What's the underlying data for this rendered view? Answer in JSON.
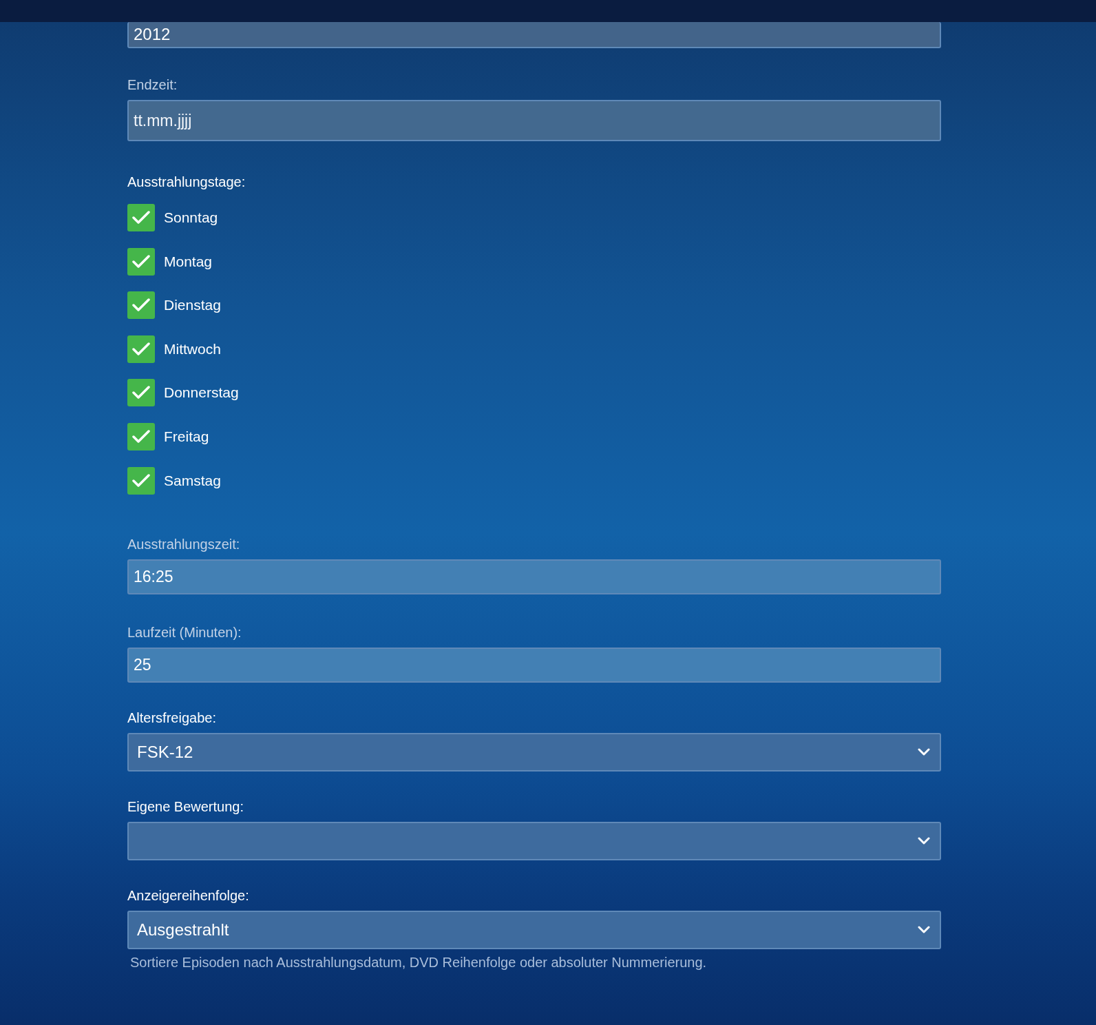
{
  "top_field": {
    "value": "2012"
  },
  "sections": [
    {
      "kind": "date",
      "label": "Endzeit:",
      "placeholder": "tt.mm.jjjj"
    },
    {
      "kind": "days",
      "label": "Ausstrahlungstage:",
      "options": [
        {
          "label": "Sonntag",
          "checked": true
        },
        {
          "label": "Montag",
          "checked": true
        },
        {
          "label": "Dienstag",
          "checked": true
        },
        {
          "label": "Mittwoch",
          "checked": true
        },
        {
          "label": "Donnerstag",
          "checked": true
        },
        {
          "label": "Freitag",
          "checked": true
        },
        {
          "label": "Samstag",
          "checked": true
        }
      ]
    },
    {
      "kind": "time",
      "label": "Ausstrahlungszeit:",
      "value": "16:25"
    },
    {
      "kind": "number",
      "label": "Laufzeit (Minuten):",
      "value": "25"
    },
    {
      "kind": "select",
      "label": "Altersfreigabe:",
      "value": "FSK-12"
    },
    {
      "kind": "select",
      "label": "Eigene Bewertung:"
    },
    {
      "kind": "select",
      "label": "Anzeigereihenfolge:",
      "value": "Ausgestrahlt",
      "help": "Sortiere Episoden nach Ausstrahlungsdatum, DVD Reihenfolge oder absoluter Nummerierung."
    }
  ]
}
